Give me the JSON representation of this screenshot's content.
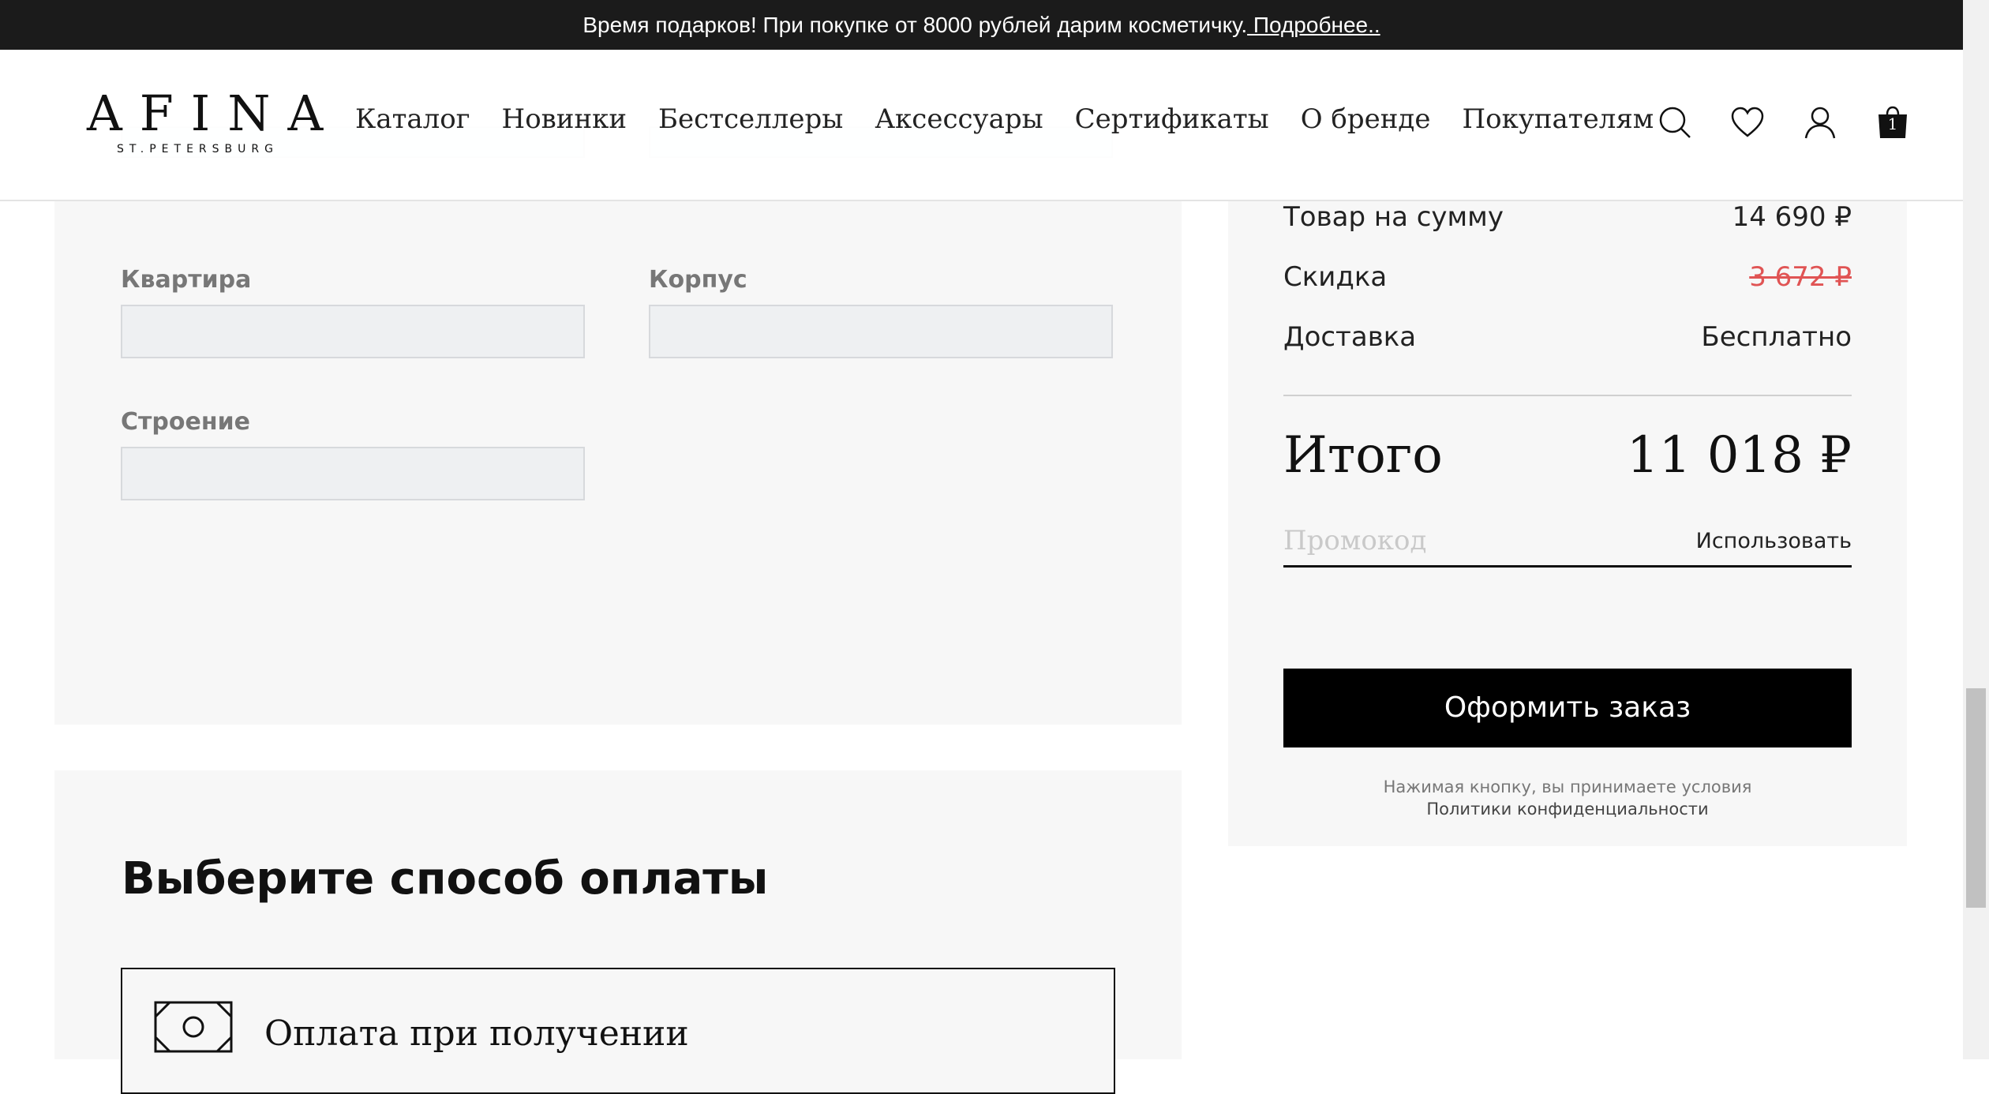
{
  "announcement": {
    "text": "Время подарков! При покупке от 8000 рублей дарим косметичку.",
    "link": " Подробнее.."
  },
  "header": {
    "logo_main": "AFINA",
    "logo_sub": "ST.PETERSBURG",
    "nav": [
      "Каталог",
      "Новинки",
      "Бестселлеры",
      "Аксессуары",
      "Сертификаты",
      "О бренде",
      "Покупателям"
    ],
    "icons": [
      "search-icon",
      "heart-icon",
      "user-icon",
      "cart-icon"
    ],
    "cart_count": "1"
  },
  "address_form": {
    "fields": [
      {
        "label": "Квартира",
        "value": ""
      },
      {
        "label": "Корпус",
        "value": ""
      },
      {
        "label": "Строение",
        "value": ""
      }
    ]
  },
  "payment": {
    "title": "Выберите способ оплаты",
    "option_label": "Оплата при получении",
    "option_icon": "cash-icon"
  },
  "summary": {
    "rows": [
      {
        "label": "Товар на сумму",
        "value": "14 690 ₽"
      },
      {
        "label": "Скидка",
        "value": "3 672 ₽"
      },
      {
        "label": "Доставка",
        "value": "Бесплатно"
      }
    ],
    "total_label": "Итого",
    "total_value": "11 018 ₽",
    "promo_placeholder": "Промокод",
    "promo_apply": "Использовать",
    "order_button": "Оформить заказ",
    "terms_line1": "Нажимая кнопку, вы принимаете условия",
    "terms_link": "Политики конфиденциальности"
  },
  "colors": {
    "topbar_bg": "#1b1b1b",
    "panel_bg": "#f7f7f7",
    "discount": "#e05454",
    "button_bg": "#000000"
  }
}
